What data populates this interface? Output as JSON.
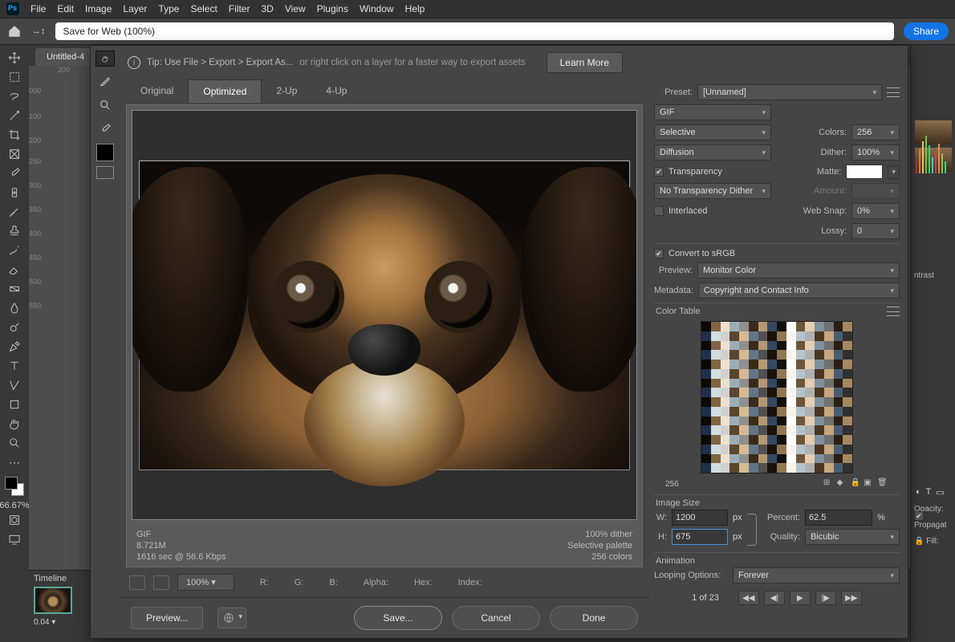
{
  "menubar": [
    "File",
    "Edit",
    "Image",
    "Layer",
    "Type",
    "Select",
    "Filter",
    "3D",
    "View",
    "Plugins",
    "Window",
    "Help"
  ],
  "optionbar": {
    "address": "Save for Web (100%)",
    "share": "Share"
  },
  "workspace": {
    "doc_tab": "Untitled-4",
    "zoom": "66.67%",
    "ruler_h": [
      "200"
    ],
    "ruler_v": [
      "000",
      "100",
      "200",
      "250",
      "300",
      "350",
      "400",
      "450",
      "500",
      "550"
    ]
  },
  "timeline": {
    "title": "Timeline",
    "frame1_time": "0.04",
    "frame_units": "▾"
  },
  "right_panel": {
    "brightness_contrast": "ntrast",
    "propagate": "Propagat",
    "opacity": "Opacity:",
    "fill": "Fill:"
  },
  "sfw": {
    "tip_prefix": "Tip: Use File > Export > Export As...",
    "tip_suffix": "or right click on a layer for a faster way to export assets",
    "learn_more": "Learn More",
    "tabs": [
      "Original",
      "Optimized",
      "2-Up",
      "4-Up"
    ],
    "active_tab": "Optimized",
    "preset_lbl": "Preset:",
    "preset_val": "[Unnamed]",
    "format_val": "GIF",
    "reduction_val": "Selective",
    "colors_lbl": "Colors:",
    "colors_val": "256",
    "dither_algo": "Diffusion",
    "dither_lbl": "Dither:",
    "dither_val": "100%",
    "transparency_lbl": "Transparency",
    "matte_lbl": "Matte:",
    "trans_dither_val": "No Transparency Dither",
    "amount_lbl": "Amount:",
    "interlaced_lbl": "Interlaced",
    "websnap_lbl": "Web Snap:",
    "websnap_val": "0%",
    "lossy_lbl": "Lossy:",
    "lossy_val": "0",
    "srgb_lbl": "Convert to sRGB",
    "preview_lbl": "Preview:",
    "preview_val": "Monitor Color",
    "metadata_lbl": "Metadata:",
    "metadata_val": "Copyright and Contact Info",
    "color_table_lbl": "Color Table",
    "ct_count": "256",
    "image_size_lbl": "Image Size",
    "w_lbl": "W:",
    "w_val": "1200",
    "h_lbl": "H:",
    "h_val": "675",
    "px": "px",
    "percent_lbl": "Percent:",
    "percent_val": "62.5",
    "percent_unit": "%",
    "quality_lbl": "Quality:",
    "quality_val": "Bicubic",
    "animation_lbl": "Animation",
    "loop_lbl": "Looping Options:",
    "loop_val": "Forever",
    "frame_counter": "1 of 23",
    "info_left": [
      "GIF",
      "8.721M",
      "1616 sec @ 56.6 Kbps"
    ],
    "info_right": [
      "100% dither",
      "Selective palette",
      "256 colors"
    ],
    "zoom_bottom": "100%",
    "readouts": [
      "R:",
      "G:",
      "B:",
      "Alpha:",
      "Hex:",
      "Index:"
    ],
    "footer": {
      "preview": "Preview...",
      "save": "Save...",
      "cancel": "Cancel",
      "done": "Done"
    }
  }
}
